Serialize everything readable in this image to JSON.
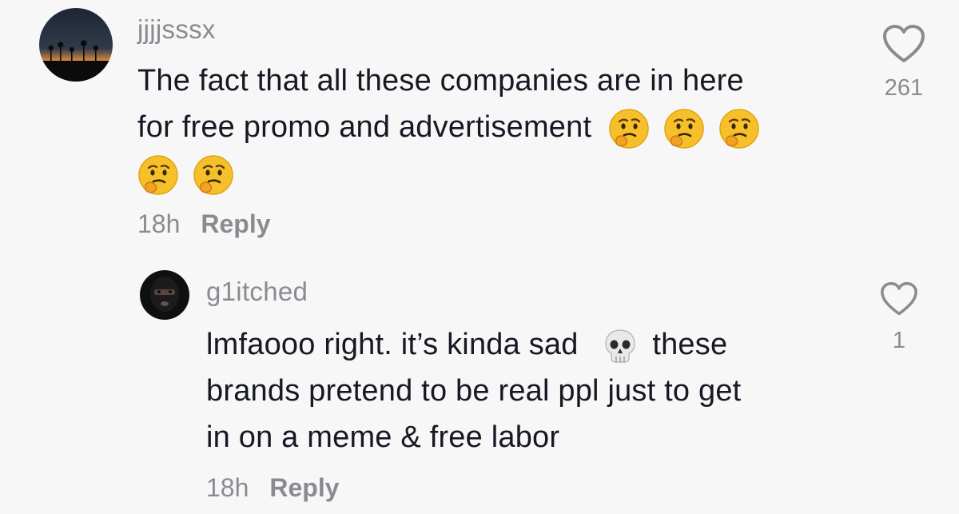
{
  "comment": {
    "username": "jjjjsssx",
    "text_line1": "The fact that all these companies are in here",
    "text_line2": "for free promo and advertisement",
    "emoji": "thinking-face",
    "time": "18h",
    "reply_label": "Reply",
    "like_count": "261"
  },
  "reply": {
    "username": "g1itched",
    "text_line1a": "lmfaooo right. it’s kinda sad",
    "emoji": "skull",
    "text_line1b": "these",
    "text_line2": "brands pretend to be real ppl just to get",
    "text_line3": "in on a meme & free labor",
    "time": "18h",
    "reply_label": "Reply",
    "like_count": "1"
  },
  "colors": {
    "background": "#f7f7f7",
    "text": "#161823",
    "secondary": "#8a8b91"
  }
}
